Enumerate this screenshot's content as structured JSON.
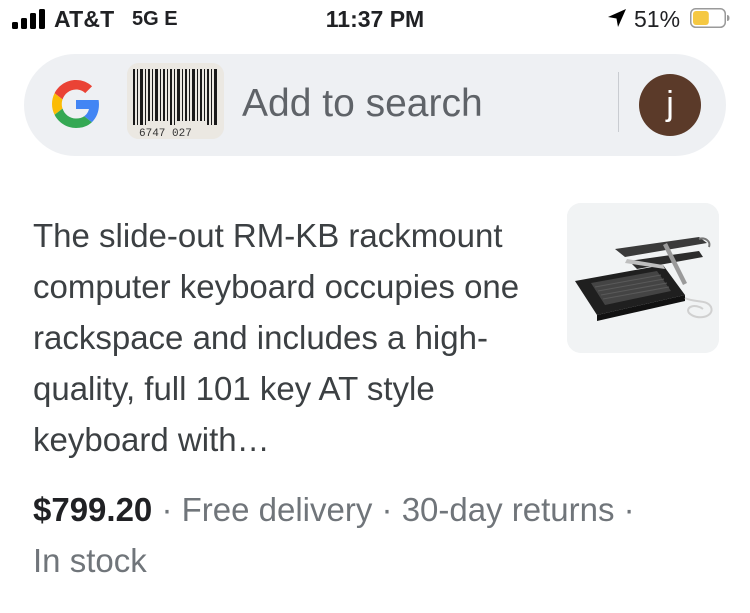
{
  "status_bar": {
    "carrier": "AT&T",
    "network": "5G E",
    "time": "11:37 PM",
    "battery_percent": "51%",
    "battery_level": 0.51,
    "battery_color": "#f5c842",
    "icons": [
      "signal-icon",
      "location-arrow-icon",
      "battery-icon"
    ]
  },
  "search_bar": {
    "logo": "google-g-logo",
    "image_query": "barcode-image",
    "barcode_digits": "6747 027",
    "placeholder": "Add to search",
    "avatar_initial": "j",
    "avatar_color": "#5b3a29"
  },
  "result": {
    "description": "The slide-out RM-KB rackmount computer keyboard occupies one rackspace and includes a high-quality, full 101 key AT style keyboard with…",
    "image": "rackmount-keyboard-image",
    "price": "$799.20",
    "separator": " · ",
    "delivery": "Free delivery",
    "returns": "30-day returns",
    "stock": "In stock"
  }
}
